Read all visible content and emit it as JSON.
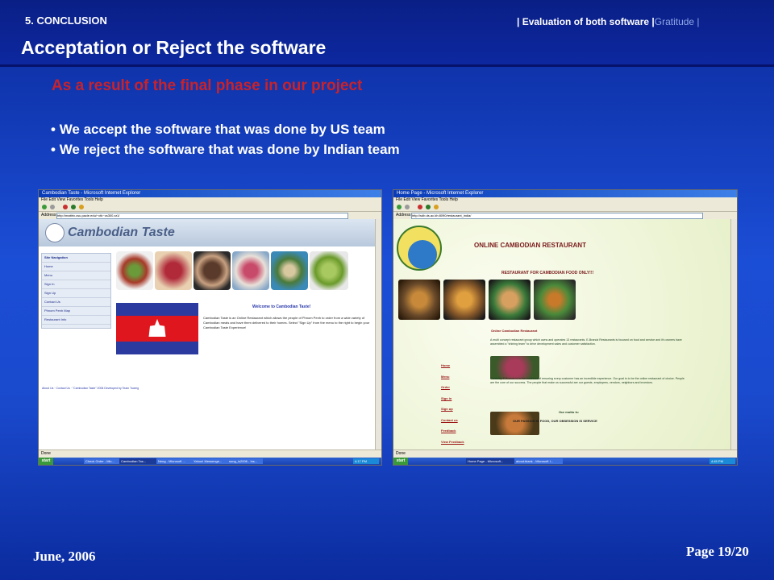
{
  "header": {
    "section": "5. CONCLUSION",
    "nav_main": "| Evaluation of both software |",
    "nav_dim": "Gratitude |",
    "title": "Acceptation or Reject the software"
  },
  "body": {
    "subtitle": "As a result of the final phase in our project",
    "bullets": [
      "We accept the software that was done by US team",
      "We reject the software that was done by Indian team"
    ]
  },
  "screenshot_us": {
    "window_title": "Cambodian Taste - Microsoft Internet Explorer",
    "menu": "File  Edit  View  Favorites  Tools  Help",
    "address_label": "Address",
    "address": "http://mattrix.csu.pacie.edu/~ctk~cs300-sr1/",
    "site_title": "Cambodian Taste",
    "nav_items": [
      "Site Navigation",
      "Home",
      "Menu",
      "Sign In",
      "Sign Up",
      "Contact Us",
      "Phnom Penh Map",
      "Restaurant Info"
    ],
    "welcome": "Welcome to Cambodian Taste!",
    "welcome_text": "Cambodian Taste is an Online Restaurant which allows the people of Phnom Penh to order from a wide variety of Cambodian meals and have them delivered to their homes. Select \"Sign Up\" from the menu to the right to begin your Cambodian Taste Experience!",
    "footer": "About Us · Contact Us · \"Cambodian Taste\" 2006 Developed by Team Tuareg",
    "status": "Done",
    "start": "start",
    "tasks": [
      "Check Order - Mic...",
      "Cambodian Tas...",
      "Neng - Microsoft ...",
      "Yahoo! Messenge...",
      "song_lu2006 - Ins..."
    ],
    "clock": "4:17 PM"
  },
  "screenshot_indian": {
    "window_title": "Home Page - Microsoft Internet Explorer",
    "menu": "File  Edit  View  Favorites  Tools  Help",
    "address_label": "Address",
    "address": "http://sdb.ds.ac.kh:8090/restaurant_india/",
    "site_title": "ONLINE CAMBODIAN RESTAURANT",
    "subtitle": "RESTAURANT FOR CAMBODIAN FOOD ONLY!!!",
    "section": "Online Cambodian Restaurant",
    "para1": "A multi concept restaurant group which owns and operates 13 restaurants. E-Brandz Restaurants is focused on food and service and it's owners have assembled a \"shining team\" to drive development sales and customer satisfaction.",
    "para2": "Currently E-Brandz is in the business of ensuring every customer has an incredible experience. Our goal is to be the online restaurant of choice. People are the core of our success. The people that make us successful are our guests, employees, vendors, neighbors and investors.",
    "links": [
      "Home",
      "Menu",
      "Order",
      "Sign in",
      "Sign up",
      "Contact us",
      "Feedback",
      "View Feedback",
      "Phnom Penh Map"
    ],
    "motto": "Our motto is:",
    "passion": "OUR PASSION IS FOOD, OUR OBSESSION IS SERVICE",
    "status": "Done",
    "start": "start",
    "tasks": [
      "Home Page - Microsoft...",
      "about:blank - Microsoft I..."
    ],
    "clock": "4:45 PM"
  },
  "footer": {
    "date": "June, 2006",
    "page": "Page 19/20"
  }
}
